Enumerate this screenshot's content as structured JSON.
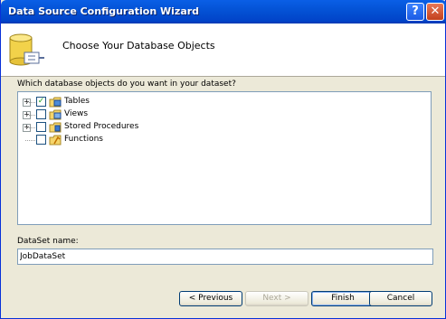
{
  "window": {
    "title": "Data Source Configuration Wizard",
    "help_glyph": "?",
    "close_glyph": "✕"
  },
  "header": {
    "title": "Choose Your Database Objects",
    "icon": "database-icon"
  },
  "question": "Which database objects do you want in your dataset?",
  "tree": {
    "items": [
      {
        "label": "Tables",
        "checked": true,
        "expander": "+",
        "icon": "table-folder-icon"
      },
      {
        "label": "Views",
        "checked": false,
        "expander": "+",
        "icon": "view-folder-icon"
      },
      {
        "label": "Stored Procedures",
        "checked": false,
        "expander": "+",
        "icon": "procedure-folder-icon"
      },
      {
        "label": "Functions",
        "checked": false,
        "expander": "",
        "icon": "function-folder-icon"
      }
    ]
  },
  "dataset": {
    "label": "DataSet name:",
    "value": "JobDataSet"
  },
  "buttons": {
    "previous": "< Previous",
    "next": "Next >",
    "finish": "Finish",
    "cancel": "Cancel"
  },
  "colors": {
    "titlebar": "#0453d6",
    "face": "#ece9d8",
    "check": "#21a121"
  }
}
